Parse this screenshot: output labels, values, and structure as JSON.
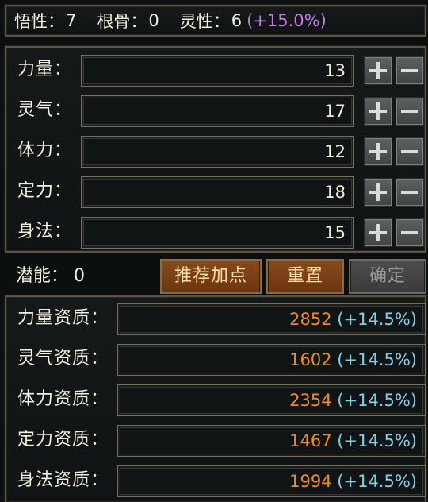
{
  "header": {
    "comprehension_label": "悟性",
    "comprehension_value": "7",
    "bone_label": "根骨",
    "bone_value": "0",
    "spirit_label": "灵性",
    "spirit_value": "6",
    "spirit_bonus": "(+15.0%)"
  },
  "attributes": [
    {
      "label": "力量",
      "value": "13"
    },
    {
      "label": "灵气",
      "value": "17"
    },
    {
      "label": "体力",
      "value": "12"
    },
    {
      "label": "定力",
      "value": "18"
    },
    {
      "label": "身法",
      "value": "15"
    }
  ],
  "potential": {
    "label": "潜能",
    "value": "0"
  },
  "buttons": {
    "recommend": "推荐加点",
    "reset": "重置",
    "confirm": "确定"
  },
  "aptitudes": [
    {
      "label": "力量资质",
      "value": "2852",
      "bonus": "(+14.5%)"
    },
    {
      "label": "灵气资质",
      "value": "1602",
      "bonus": "(+14.5%)"
    },
    {
      "label": "体力资质",
      "value": "2354",
      "bonus": "(+14.5%)"
    },
    {
      "label": "定力资质",
      "value": "1467",
      "bonus": "(+14.5%)"
    },
    {
      "label": "身法资质",
      "value": "1994",
      "bonus": "(+14.5%)"
    }
  ],
  "colors": {
    "bonus_purple": "#c57ae6",
    "aptitude_value": "#f08a24",
    "aptitude_bonus": "#86cde6"
  }
}
